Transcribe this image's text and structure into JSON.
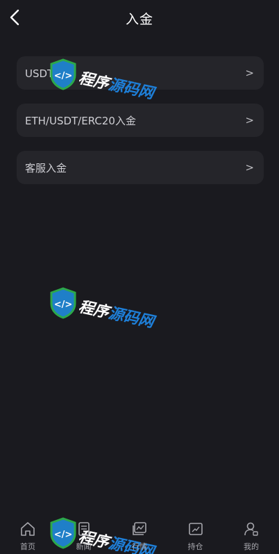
{
  "header": {
    "title": "入金",
    "back_icon": "chevron-left-icon"
  },
  "menu": {
    "items": [
      {
        "label": "USDT入金",
        "arrow": ">"
      },
      {
        "label": "ETH/USDT/ERC20入金",
        "arrow": ">"
      },
      {
        "label": "客服入金",
        "arrow": ">"
      }
    ]
  },
  "watermark": {
    "text_part1": "程序",
    "text_part2": "源码网"
  },
  "bottom_nav": {
    "items": [
      {
        "label": "首页",
        "icon": "home-icon"
      },
      {
        "label": "新闻",
        "icon": "news-icon"
      },
      {
        "label": "行情",
        "icon": "market-icon"
      },
      {
        "label": "持仓",
        "icon": "position-icon"
      },
      {
        "label": "我的",
        "icon": "profile-icon"
      }
    ]
  },
  "colors": {
    "background": "#1a1a1f",
    "card": "#25252a",
    "text": "#cfcfd4",
    "watermark_blue": "#1e7fd8"
  }
}
